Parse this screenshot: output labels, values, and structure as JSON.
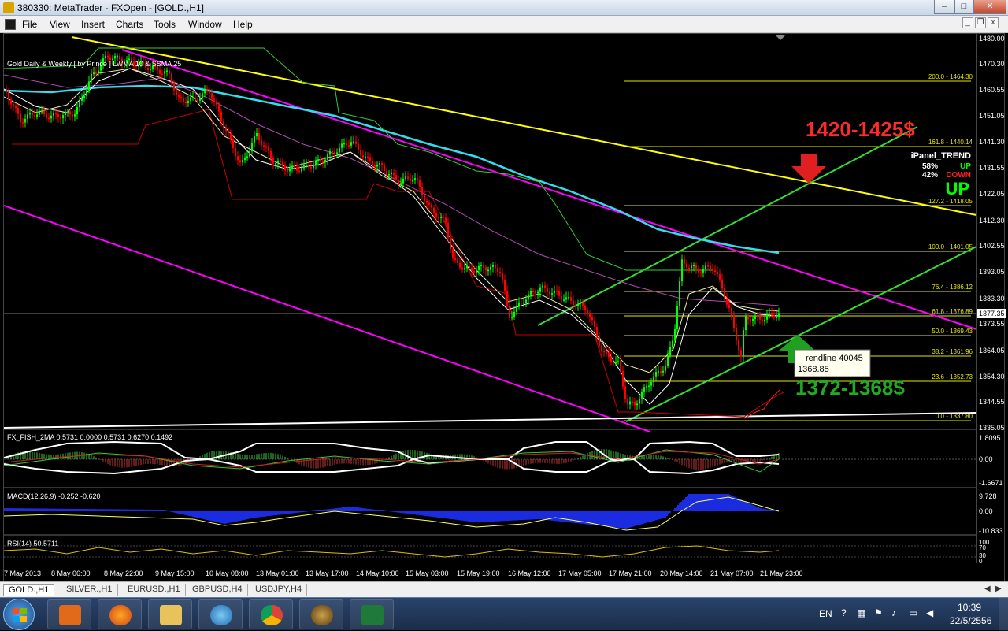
{
  "window": {
    "title": "380330: MetaTrader - FXOpen - [GOLD.,H1]"
  },
  "menu": [
    "File",
    "View",
    "Insert",
    "Charts",
    "Tools",
    "Window",
    "Help"
  ],
  "chart": {
    "indicator_label": "Gold Daily & Weekly [ by Prince ]  LWMA 10  &  SSMA 25",
    "price_labels": [
      "1480.00",
      "1470.30",
      "1460.55",
      "1451.05",
      "1441.30",
      "1431.55",
      "1422.05",
      "1412.30",
      "1402.55",
      "1393.05",
      "1383.30",
      "1373.55",
      "1364.05",
      "1354.30",
      "1344.55",
      "1335.05"
    ],
    "current_price": "1377.35",
    "fib_levels": [
      "200.0 - 1464.30",
      "161.8 - 1440.14",
      "127.2 - 1418.05",
      "100.0 - 1401.05",
      "76.4 - 1386.12",
      "61.8 - 1376.89",
      "50.0 - 1369.43",
      "38.2 - 1361.96",
      "23.6 - 1352.73",
      "0.0 - 1337.80"
    ],
    "annotation_top": "1420-1425$",
    "annotation_bottom": "1372-1368$",
    "tooltip_line1": "rendline 40045",
    "tooltip_line2": "1368.85",
    "ipanel": {
      "title": "iPanel_TREND",
      "up_pct": "58%",
      "up_label": "UP",
      "down_pct": "42%",
      "down_label": "DOWN",
      "signal": "UP"
    },
    "fisher": {
      "label": "FX_FISH_2MA 0.5731 0.0000 0.5731 0.6270 0.1492",
      "scale": [
        "1.8095",
        "0.00",
        "-1.6671"
      ]
    },
    "macd": {
      "label": "MACD(12,26,9) -0.252 -0.620",
      "scale": [
        "9.728",
        "0.00",
        "-10.833"
      ]
    },
    "rsi": {
      "label": "RSI(14) 50.5711",
      "scale": [
        "100",
        "70",
        "30",
        "0"
      ]
    },
    "time_labels": [
      "7 May 2013",
      "8 May 06:00",
      "8 May 22:00",
      "9 May 15:00",
      "10 May 08:00",
      "13 May 01:00",
      "13 May 17:00",
      "14 May 10:00",
      "15 May 03:00",
      "15 May 19:00",
      "16 May 12:00",
      "17 May 05:00",
      "17 May 21:00",
      "20 May 14:00",
      "21 May 07:00",
      "21 May 23:00"
    ]
  },
  "tabs": [
    "GOLD.,H1",
    "SILVER.,H1",
    "EURUSD.,H1",
    "GBPUSD,H4",
    "USDJPY,H4"
  ],
  "taskbar": {
    "lang": "EN",
    "time": "10:39",
    "date": "22/5/2556"
  },
  "colors": {
    "bull": "#00ff00",
    "bear": "#ff0000",
    "fib": "#e6e600",
    "channel": "#ff00ff",
    "trend": "#ffff00",
    "ma_cyan": "#33ddee"
  }
}
